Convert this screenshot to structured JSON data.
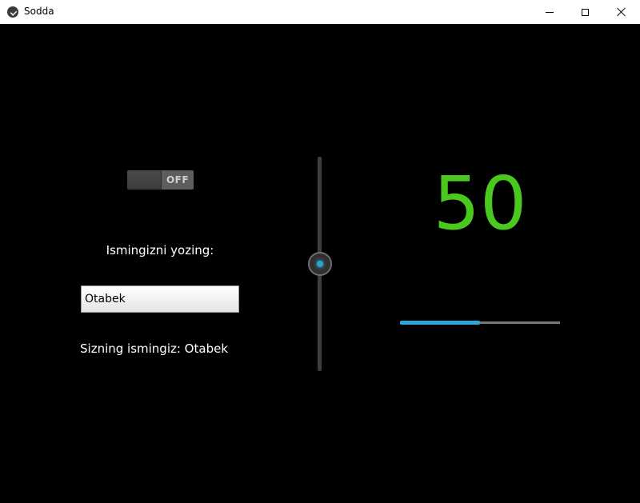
{
  "window": {
    "title": "Sodda",
    "icon": "kivy-icon"
  },
  "toggle": {
    "state_label": "OFF",
    "active": false
  },
  "form": {
    "prompt": "Ismingizni yozing:",
    "input_value": "Otabek",
    "result_text": "Sizning ismingiz: Otabek"
  },
  "slider": {
    "orientation": "vertical",
    "value": 50,
    "max": 100,
    "accent": "#2aa5d6"
  },
  "display": {
    "value": "50",
    "color": "#4bc81e"
  },
  "progress": {
    "value": 50,
    "max": 100,
    "color": "#2aa8db"
  }
}
